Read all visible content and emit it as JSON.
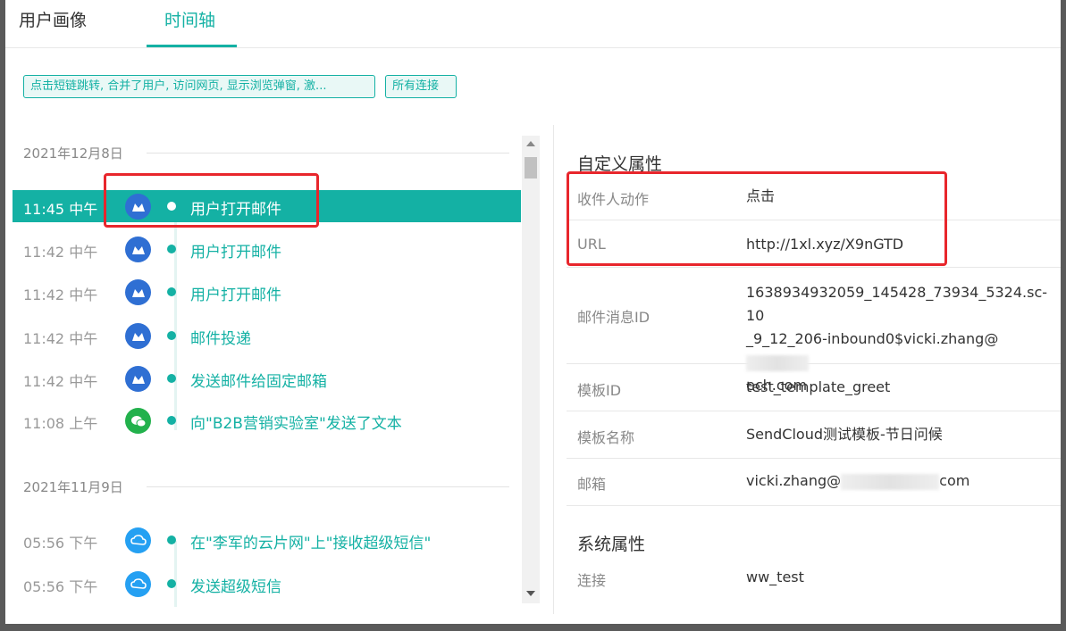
{
  "tabs": [
    {
      "label": "用户画像"
    },
    {
      "label": "时间轴"
    }
  ],
  "filters": {
    "actions_chip": "点击短链跳转, 合并了用户, 访问网页, 显示浏览弹窗, 激...",
    "links_chip": "所有连接"
  },
  "timeline": {
    "groups": [
      {
        "date": "2021年12月8日",
        "events": [
          {
            "time": "11:45 中午",
            "icon": "mail-icon",
            "label": "用户打开邮件",
            "active": true
          },
          {
            "time": "11:42 中午",
            "icon": "mail-icon",
            "label": "用户打开邮件"
          },
          {
            "time": "11:42 中午",
            "icon": "mail-icon",
            "label": "用户打开邮件"
          },
          {
            "time": "11:42 中午",
            "icon": "mail-icon",
            "label": "邮件投递"
          },
          {
            "time": "11:42 中午",
            "icon": "mail-icon",
            "label": "发送邮件给固定邮箱"
          },
          {
            "time": "11:08 上午",
            "icon": "wechat-icon",
            "label": "向\"B2B营销实验室\"发送了文本"
          }
        ]
      },
      {
        "date": "2021年11月9日",
        "events": [
          {
            "time": "05:56 下午",
            "icon": "cloud-sms-icon",
            "label": "在\"李军的云片网\"上\"接收超级短信\""
          },
          {
            "time": "05:56 下午",
            "icon": "cloud-sms-icon",
            "label": "发送超级短信"
          }
        ]
      }
    ]
  },
  "custom_props": {
    "title": "自定义属性",
    "rows": [
      {
        "key": "收件人动作",
        "value": "点击"
      },
      {
        "key": "URL",
        "value": "http://1xl.xyz/X9nGTD"
      },
      {
        "key": "邮件消息ID",
        "value_lines": [
          "1638934932059_145428_73934_5324.sc-10",
          "_9_12_206-inbound0$vicki.zhang@",
          "ech.com"
        ]
      },
      {
        "key": "模板ID",
        "value": "test_template_greet"
      },
      {
        "key": "模板名称",
        "value": "SendCloud测试模板-节日问候"
      },
      {
        "key": "邮箱",
        "value_prefix": "vicki.zhang@",
        "value_suffix": "com"
      }
    ]
  },
  "system_props": {
    "title": "系统属性",
    "rows": [
      {
        "key": "连接",
        "value": "ww_test"
      }
    ]
  },
  "colors": {
    "accent": "#14b1a4",
    "highlight_box": "#e8262c",
    "mail_icon": "#2f6fd3",
    "wechat_icon": "#22b14c",
    "cloud_icon": "#25a0f2"
  }
}
